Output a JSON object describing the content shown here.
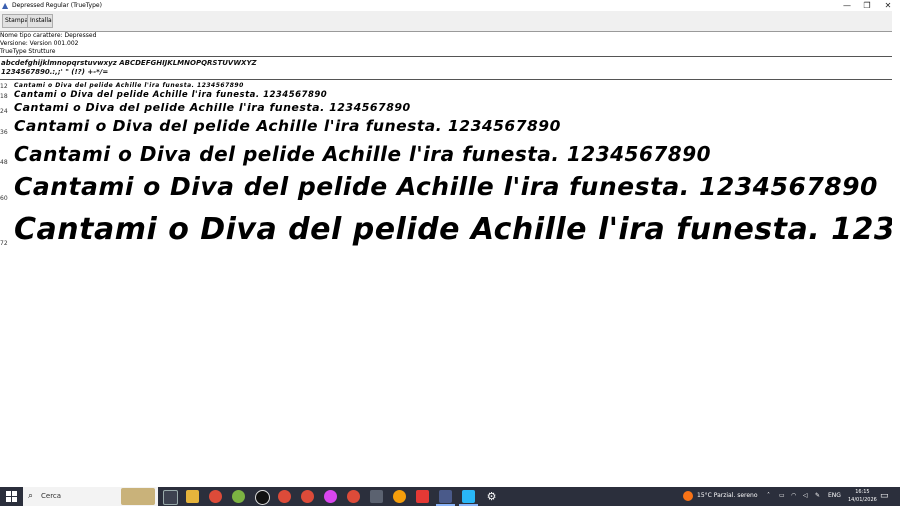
{
  "window": {
    "title": "Depressed Regular (TrueType)",
    "controls": [
      "—",
      "❐",
      "✕"
    ]
  },
  "toolbar": {
    "print_label": "Stampa",
    "install_label": "Installa"
  },
  "info": {
    "name": "Nome tipo carattere: Depressed",
    "version": "Versione: Version 001.002",
    "type": "TrueType Strutture"
  },
  "charset": {
    "line1": "abcdefghijklmnopqrstuvwxyz ABCDEFGHIJKLMNOPQRSTUVWXYZ",
    "line2": "1234567890.:,;' \" (!?) +-*/="
  },
  "sample_text": "Cantami o Diva del pelide Achille l'ira funesta. 1234567890",
  "sizes": [
    {
      "label": "12"
    },
    {
      "label": "18"
    },
    {
      "label": "24"
    },
    {
      "label": "36"
    },
    {
      "label": "48"
    },
    {
      "label": "60"
    },
    {
      "label": "72"
    }
  ],
  "taskbar": {
    "search_placeholder": "Cerca",
    "weather": "15°C  Parzial. sereno",
    "language": "ENG",
    "time": "16:15",
    "date": "14/01/2026",
    "accent": "#8ab4f8",
    "background": "#2b2f3c"
  }
}
